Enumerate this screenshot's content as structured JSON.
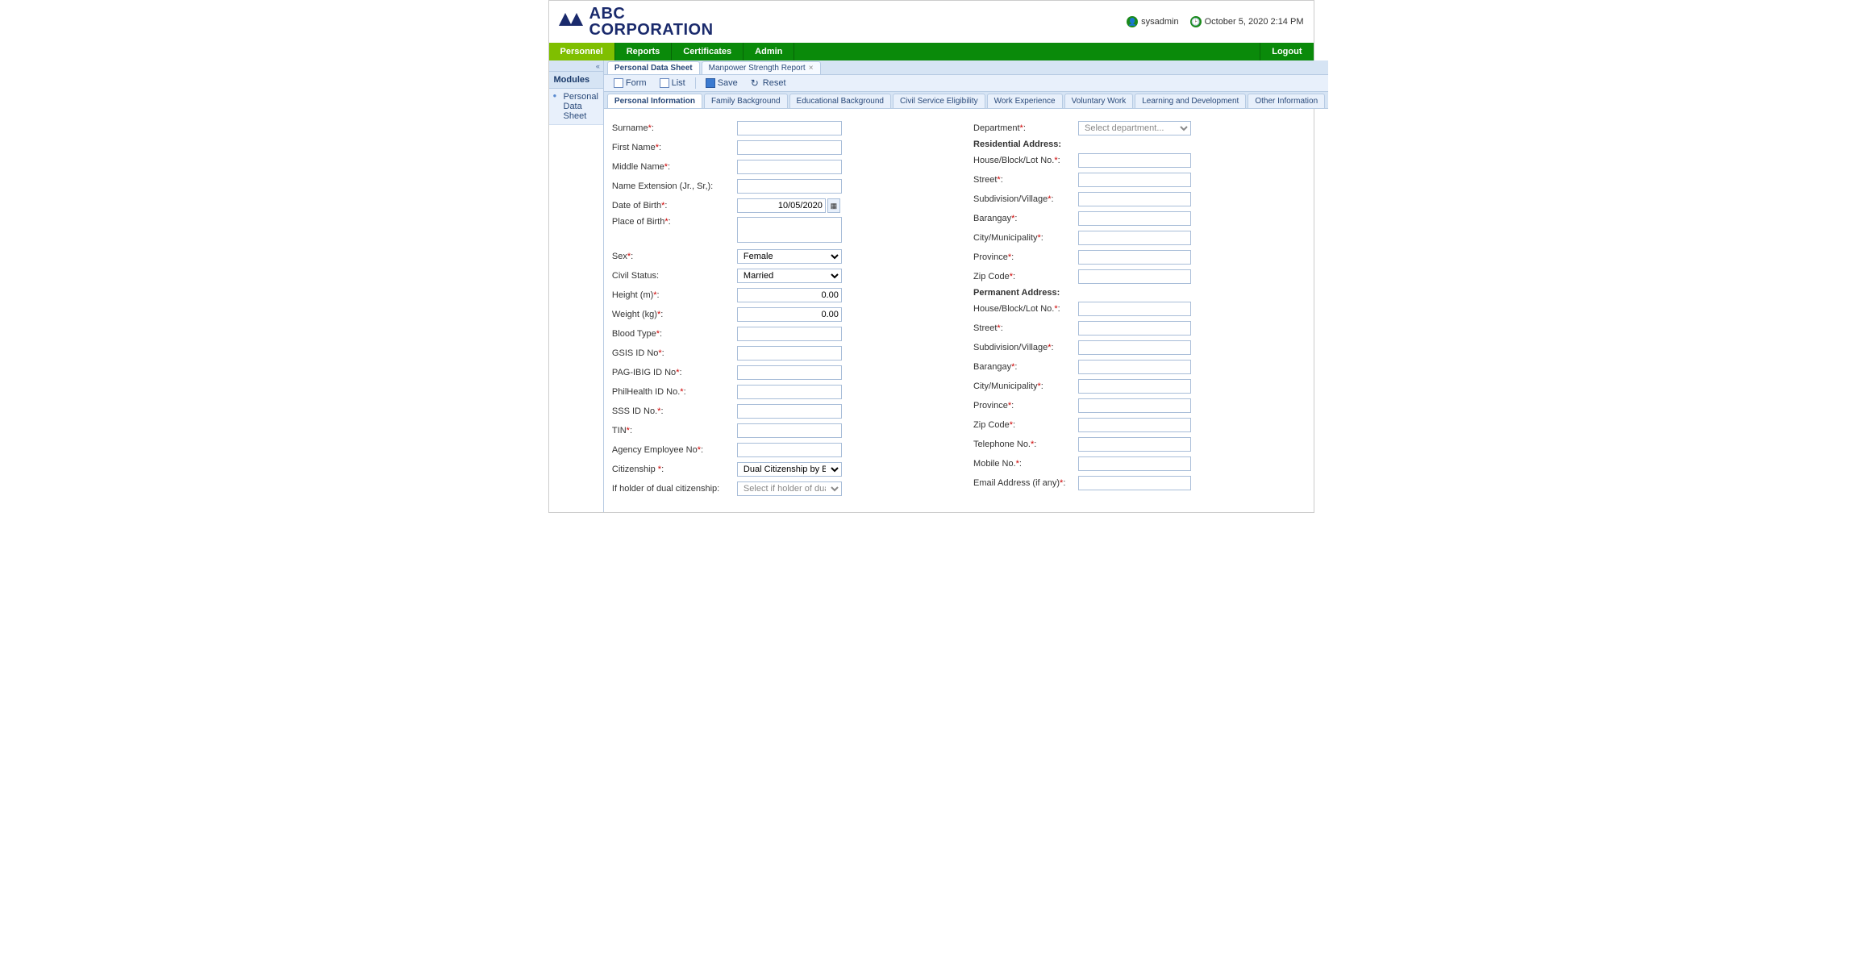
{
  "header": {
    "company_line1": "ABC",
    "company_line2": "CORPORATION",
    "user": "sysadmin",
    "datetime": "October 5, 2020 2:14 PM"
  },
  "nav": {
    "items": [
      "Personnel",
      "Reports",
      "Certificates",
      "Admin"
    ],
    "logout": "Logout"
  },
  "sidebar": {
    "collapse": "«",
    "header": "Modules",
    "items": [
      "Personal Data Sheet"
    ]
  },
  "doc_tabs": [
    {
      "label": "Personal Data Sheet",
      "active": true
    },
    {
      "label": "Manpower Strength Report",
      "active": false
    }
  ],
  "toolbar": {
    "form": "Form",
    "list": "List",
    "save": "Save",
    "reset": "Reset"
  },
  "sub_tabs": [
    "Personal Information",
    "Family Background",
    "Educational Background",
    "Civil Service Eligibility",
    "Work Experience",
    "Voluntary Work",
    "Learning and Development",
    "Other Information"
  ],
  "form": {
    "left": {
      "surname": "Surname",
      "first_name": "First Name",
      "middle_name": "Middle Name",
      "name_ext": "Name Extension (Jr., Sr,):",
      "dob": "Date of Birth",
      "dob_value": "10/05/2020",
      "pob": "Place of Birth",
      "sex": "Sex",
      "sex_value": "Female",
      "civil_status": "Civil Status:",
      "civil_status_value": "Married",
      "height": "Height (m)",
      "height_value": "0.00",
      "weight": "Weight (kg)",
      "weight_value": "0.00",
      "blood_type": "Blood Type",
      "gsis": "GSIS ID No",
      "pagibig": "PAG-IBIG ID No",
      "philhealth": "PhilHealth ID No.",
      "sss": "SSS ID No.",
      "tin": "TIN",
      "agency_emp": "Agency Employee No",
      "citizenship": "Citizenship ",
      "citizenship_value": "Dual Citizenship by Birth",
      "dual_holder": "If holder of dual citizenship:",
      "dual_holder_placeholder": "Select if holder of dual citizenshi"
    },
    "right": {
      "department": "Department",
      "department_placeholder": "Select department...",
      "res_head": "Residential Address:",
      "house": "House/Block/Lot No.",
      "street": "Street",
      "subdiv": "Subdivision/Village",
      "barangay": "Barangay",
      "city": "City/Municipality",
      "province": "Province",
      "zip": "Zip Code",
      "perm_head": "Permanent Address:",
      "p_house": "House/Block/Lot No.",
      "p_street": "Street",
      "p_subdiv": "Subdivision/Village",
      "p_barangay": "Barangay",
      "p_city": "City/Municipality",
      "p_province": "Province",
      "p_zip": "Zip Code",
      "telephone": "Telephone No.",
      "mobile": "Mobile No.",
      "email": "Email Address (if any)"
    }
  }
}
